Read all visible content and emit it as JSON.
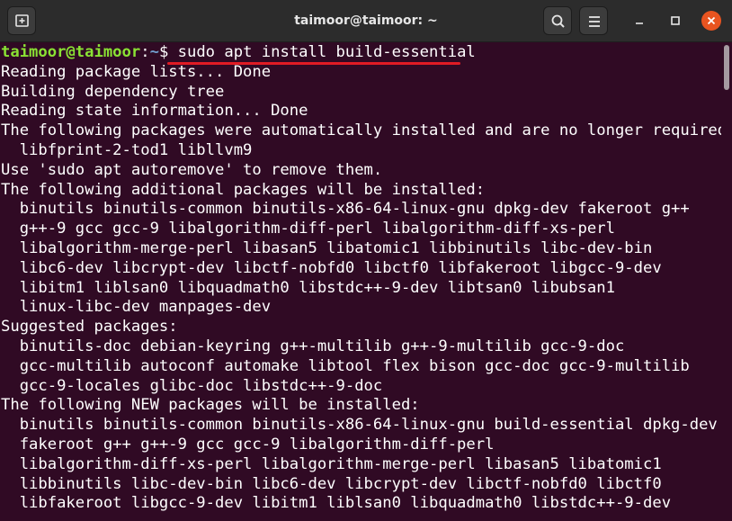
{
  "window": {
    "title": "taimoor@taimoor: ~"
  },
  "icons": {
    "new_tab": "new-tab-icon",
    "search": "search-icon",
    "menu": "hamburger-menu-icon",
    "minimize": "minimize-icon",
    "maximize": "maximize-icon",
    "close": "close-icon"
  },
  "colors": {
    "terminal_bg": "#300a24",
    "titlebar_bg": "#2c2c2c",
    "prompt_user": "#8ae234",
    "prompt_path": "#729fcf",
    "text": "#ffffff",
    "underline": "#e01b24",
    "close_button": "#e95420"
  },
  "prompt": {
    "user_host": "taimoor@taimoor",
    "separator": ":",
    "path": "~",
    "symbol": "$ ",
    "command": "sudo apt install build-essential"
  },
  "output_lines": [
    "Reading package lists... Done",
    "Building dependency tree",
    "Reading state information... Done",
    "The following packages were automatically installed and are no longer required:",
    "  libfprint-2-tod1 libllvm9",
    "Use 'sudo apt autoremove' to remove them.",
    "The following additional packages will be installed:",
    "  binutils binutils-common binutils-x86-64-linux-gnu dpkg-dev fakeroot g++",
    "  g++-9 gcc gcc-9 libalgorithm-diff-perl libalgorithm-diff-xs-perl",
    "  libalgorithm-merge-perl libasan5 libatomic1 libbinutils libc-dev-bin",
    "  libc6-dev libcrypt-dev libctf-nobfd0 libctf0 libfakeroot libgcc-9-dev",
    "  libitm1 liblsan0 libquadmath0 libstdc++-9-dev libtsan0 libubsan1",
    "  linux-libc-dev manpages-dev",
    "Suggested packages:",
    "  binutils-doc debian-keyring g++-multilib g++-9-multilib gcc-9-doc",
    "  gcc-multilib autoconf automake libtool flex bison gcc-doc gcc-9-multilib",
    "  gcc-9-locales glibc-doc libstdc++-9-doc",
    "The following NEW packages will be installed:",
    "  binutils binutils-common binutils-x86-64-linux-gnu build-essential dpkg-dev",
    "  fakeroot g++ g++-9 gcc gcc-9 libalgorithm-diff-perl",
    "  libalgorithm-diff-xs-perl libalgorithm-merge-perl libasan5 libatomic1",
    "  libbinutils libc-dev-bin libc6-dev libcrypt-dev libctf-nobfd0 libctf0",
    "  libfakeroot libgcc-9-dev libitm1 liblsan0 libquadmath0 libstdc++-9-dev"
  ]
}
